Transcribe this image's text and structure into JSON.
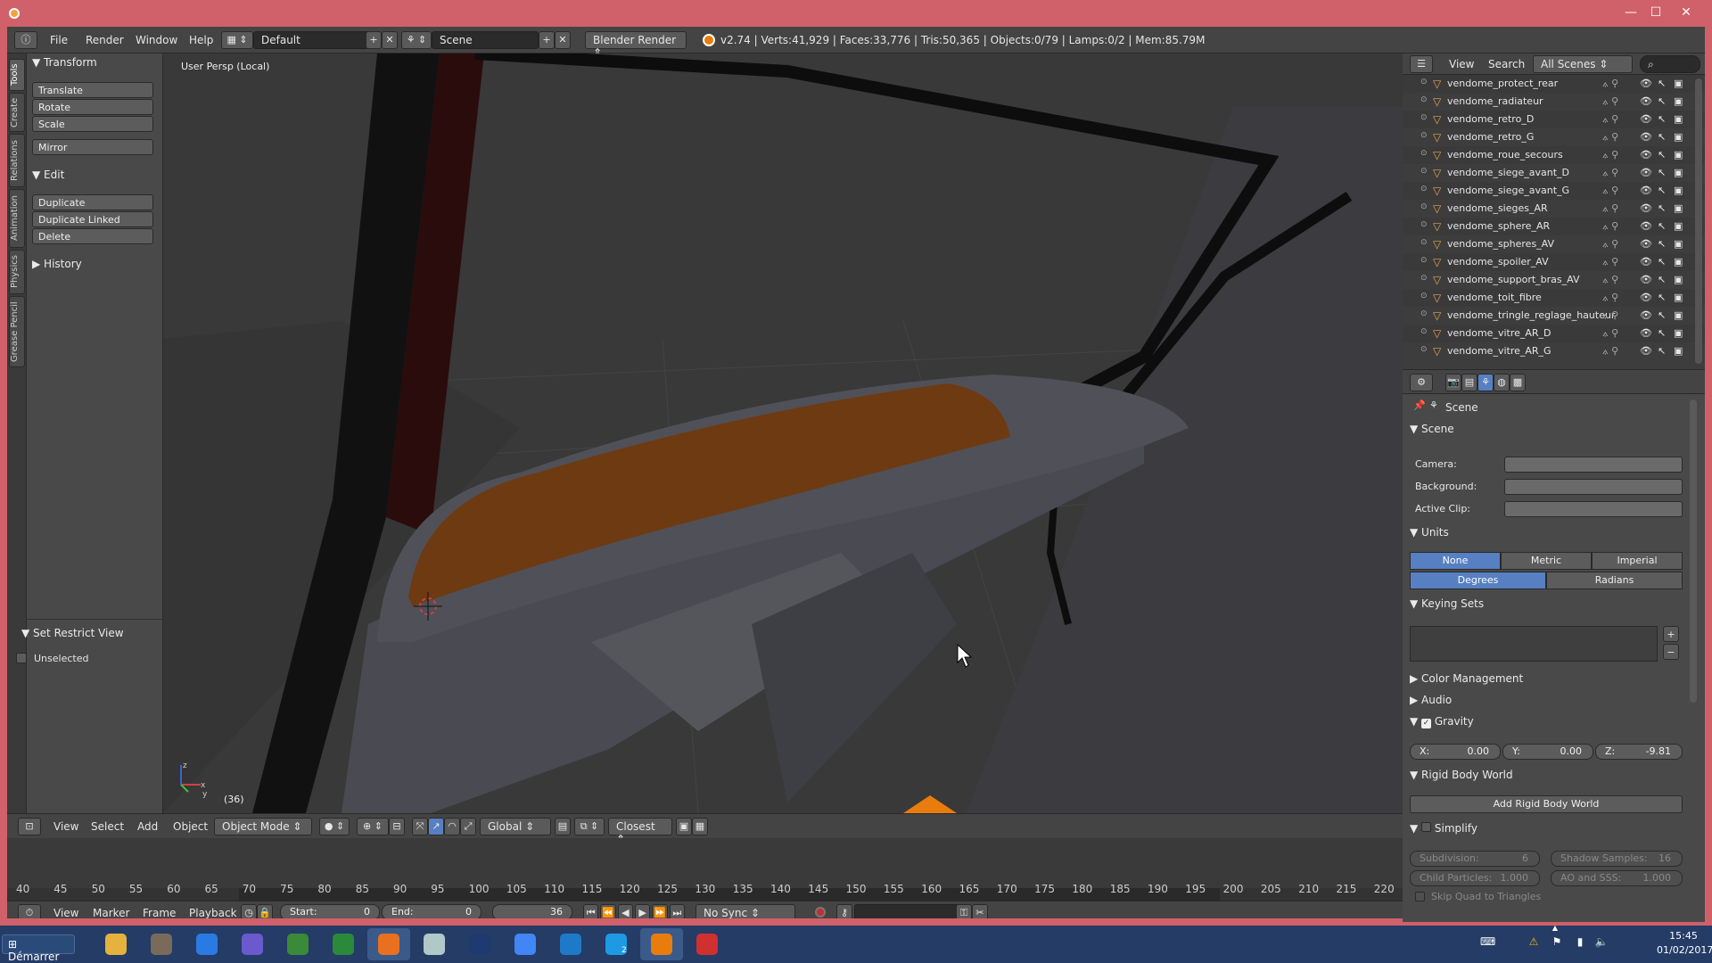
{
  "window": {
    "minimize_glyph": "—",
    "maximize_glyph": "☐",
    "close_glyph": "✕"
  },
  "info_header": {
    "menus": [
      "File",
      "Render",
      "Window",
      "Help"
    ],
    "screen_layout": "Default",
    "scene": "Scene",
    "render_engine": "Blender Render",
    "stats": "v2.74 | Verts:41,929 | Faces:33,776 | Tris:50,365 | Objects:0/79 | Lamps:0/2 | Mem:85.79M"
  },
  "tool_tabs": [
    "Tools",
    "Create",
    "Relations",
    "Animation",
    "Physics",
    "Grease Pencil"
  ],
  "tool_shelf": {
    "transform_title": "Transform",
    "transform_buttons": [
      "Translate",
      "Rotate",
      "Scale"
    ],
    "mirror": "Mirror",
    "edit_title": "Edit",
    "edit_buttons": [
      "Duplicate",
      "Duplicate Linked",
      "Delete"
    ],
    "history_title": "History",
    "restrict_title": "Set Restrict View",
    "unselected_label": "Unselected"
  },
  "viewport": {
    "view_label": "User Persp (Local)",
    "frame_label": "(36)",
    "axis_x": "x",
    "axis_y": "y",
    "axis_z": "z",
    "accent": "#e87d0d"
  },
  "view3d_header": {
    "menus": [
      "View",
      "Select",
      "Add",
      "Object"
    ],
    "mode": "Object Mode",
    "orientation": "Global",
    "snap_target": "Closest"
  },
  "timeline": {
    "ticks": [
      "40",
      "45",
      "50",
      "55",
      "60",
      "65",
      "70",
      "75",
      "80",
      "85",
      "90",
      "95",
      "100",
      "105",
      "110",
      "115",
      "120",
      "125",
      "130",
      "135",
      "140",
      "145",
      "150",
      "155",
      "160",
      "165",
      "170",
      "175",
      "180",
      "185",
      "190",
      "195",
      "200",
      "205",
      "210",
      "215",
      "220"
    ],
    "menus": [
      "View",
      "Marker",
      "Frame",
      "Playback"
    ],
    "start_label": "Start:",
    "start_value": "0",
    "end_label": "End:",
    "end_value": "0",
    "current_frame": "36",
    "sync": "No Sync"
  },
  "outliner": {
    "view": "View",
    "search": "Search",
    "scope": "All Scenes",
    "items": [
      "vendome_protect_rear",
      "vendome_radiateur",
      "vendome_retro_D",
      "vendome_retro_G",
      "vendome_roue_secours",
      "vendome_siege_avant_D",
      "vendome_siege_avant_G",
      "vendome_sieges_AR",
      "vendome_sphere_AR",
      "vendome_spheres_AV",
      "vendome_spoiler_AV",
      "vendome_support_bras_AV",
      "vendome_toit_fibre",
      "vendome_tringle_reglage_hauteur",
      "vendome_vitre_AR_D",
      "vendome_vitre_AR_G"
    ]
  },
  "properties": {
    "breadcrumb": "Scene",
    "scene_title": "Scene",
    "camera_label": "Camera:",
    "background_label": "Background:",
    "active_clip_label": "Active Clip:",
    "units_title": "Units",
    "unit_systems": [
      "None",
      "Metric",
      "Imperial"
    ],
    "rotation_units": [
      "Degrees",
      "Radians"
    ],
    "keying_title": "Keying Sets",
    "color_mgmt": "Color Management",
    "audio": "Audio",
    "gravity": "Gravity",
    "gravity_x_label": "X:",
    "gravity_x": "0.00",
    "gravity_y_label": "Y:",
    "gravity_y": "0.00",
    "gravity_z_label": "Z:",
    "gravity_z": "-9.81",
    "rigid_title": "Rigid Body World",
    "rigid_button": "Add Rigid Body World",
    "simplify": "Simplify",
    "subdivision_label": "Subdivision:",
    "subdivision": "6",
    "shadow_label": "Shadow Samples:",
    "shadow": "16",
    "child_label": "Child Particles:",
    "child": "1.000",
    "ao_label": "AO and SSS:",
    "ao": "1.000",
    "skip_quad": "Skip Quad to Triangles",
    "selected_color": "#5680c2"
  },
  "taskbar": {
    "start": "Démarrer",
    "time": "15:45",
    "date": "01/02/2017",
    "apps": [
      "file-explorer",
      "gimp",
      "dropbox",
      "xnview",
      "picasa",
      "office",
      "firefox",
      "notes",
      "photoshop",
      "chrome",
      "word",
      "skype",
      "blender",
      "unknown-red-app"
    ],
    "skype_badge": "2",
    "tray": [
      "keyboard-icon",
      "warning-icon",
      "flag-icon",
      "network-icon",
      "volume-icon",
      "chevron-icon"
    ]
  }
}
